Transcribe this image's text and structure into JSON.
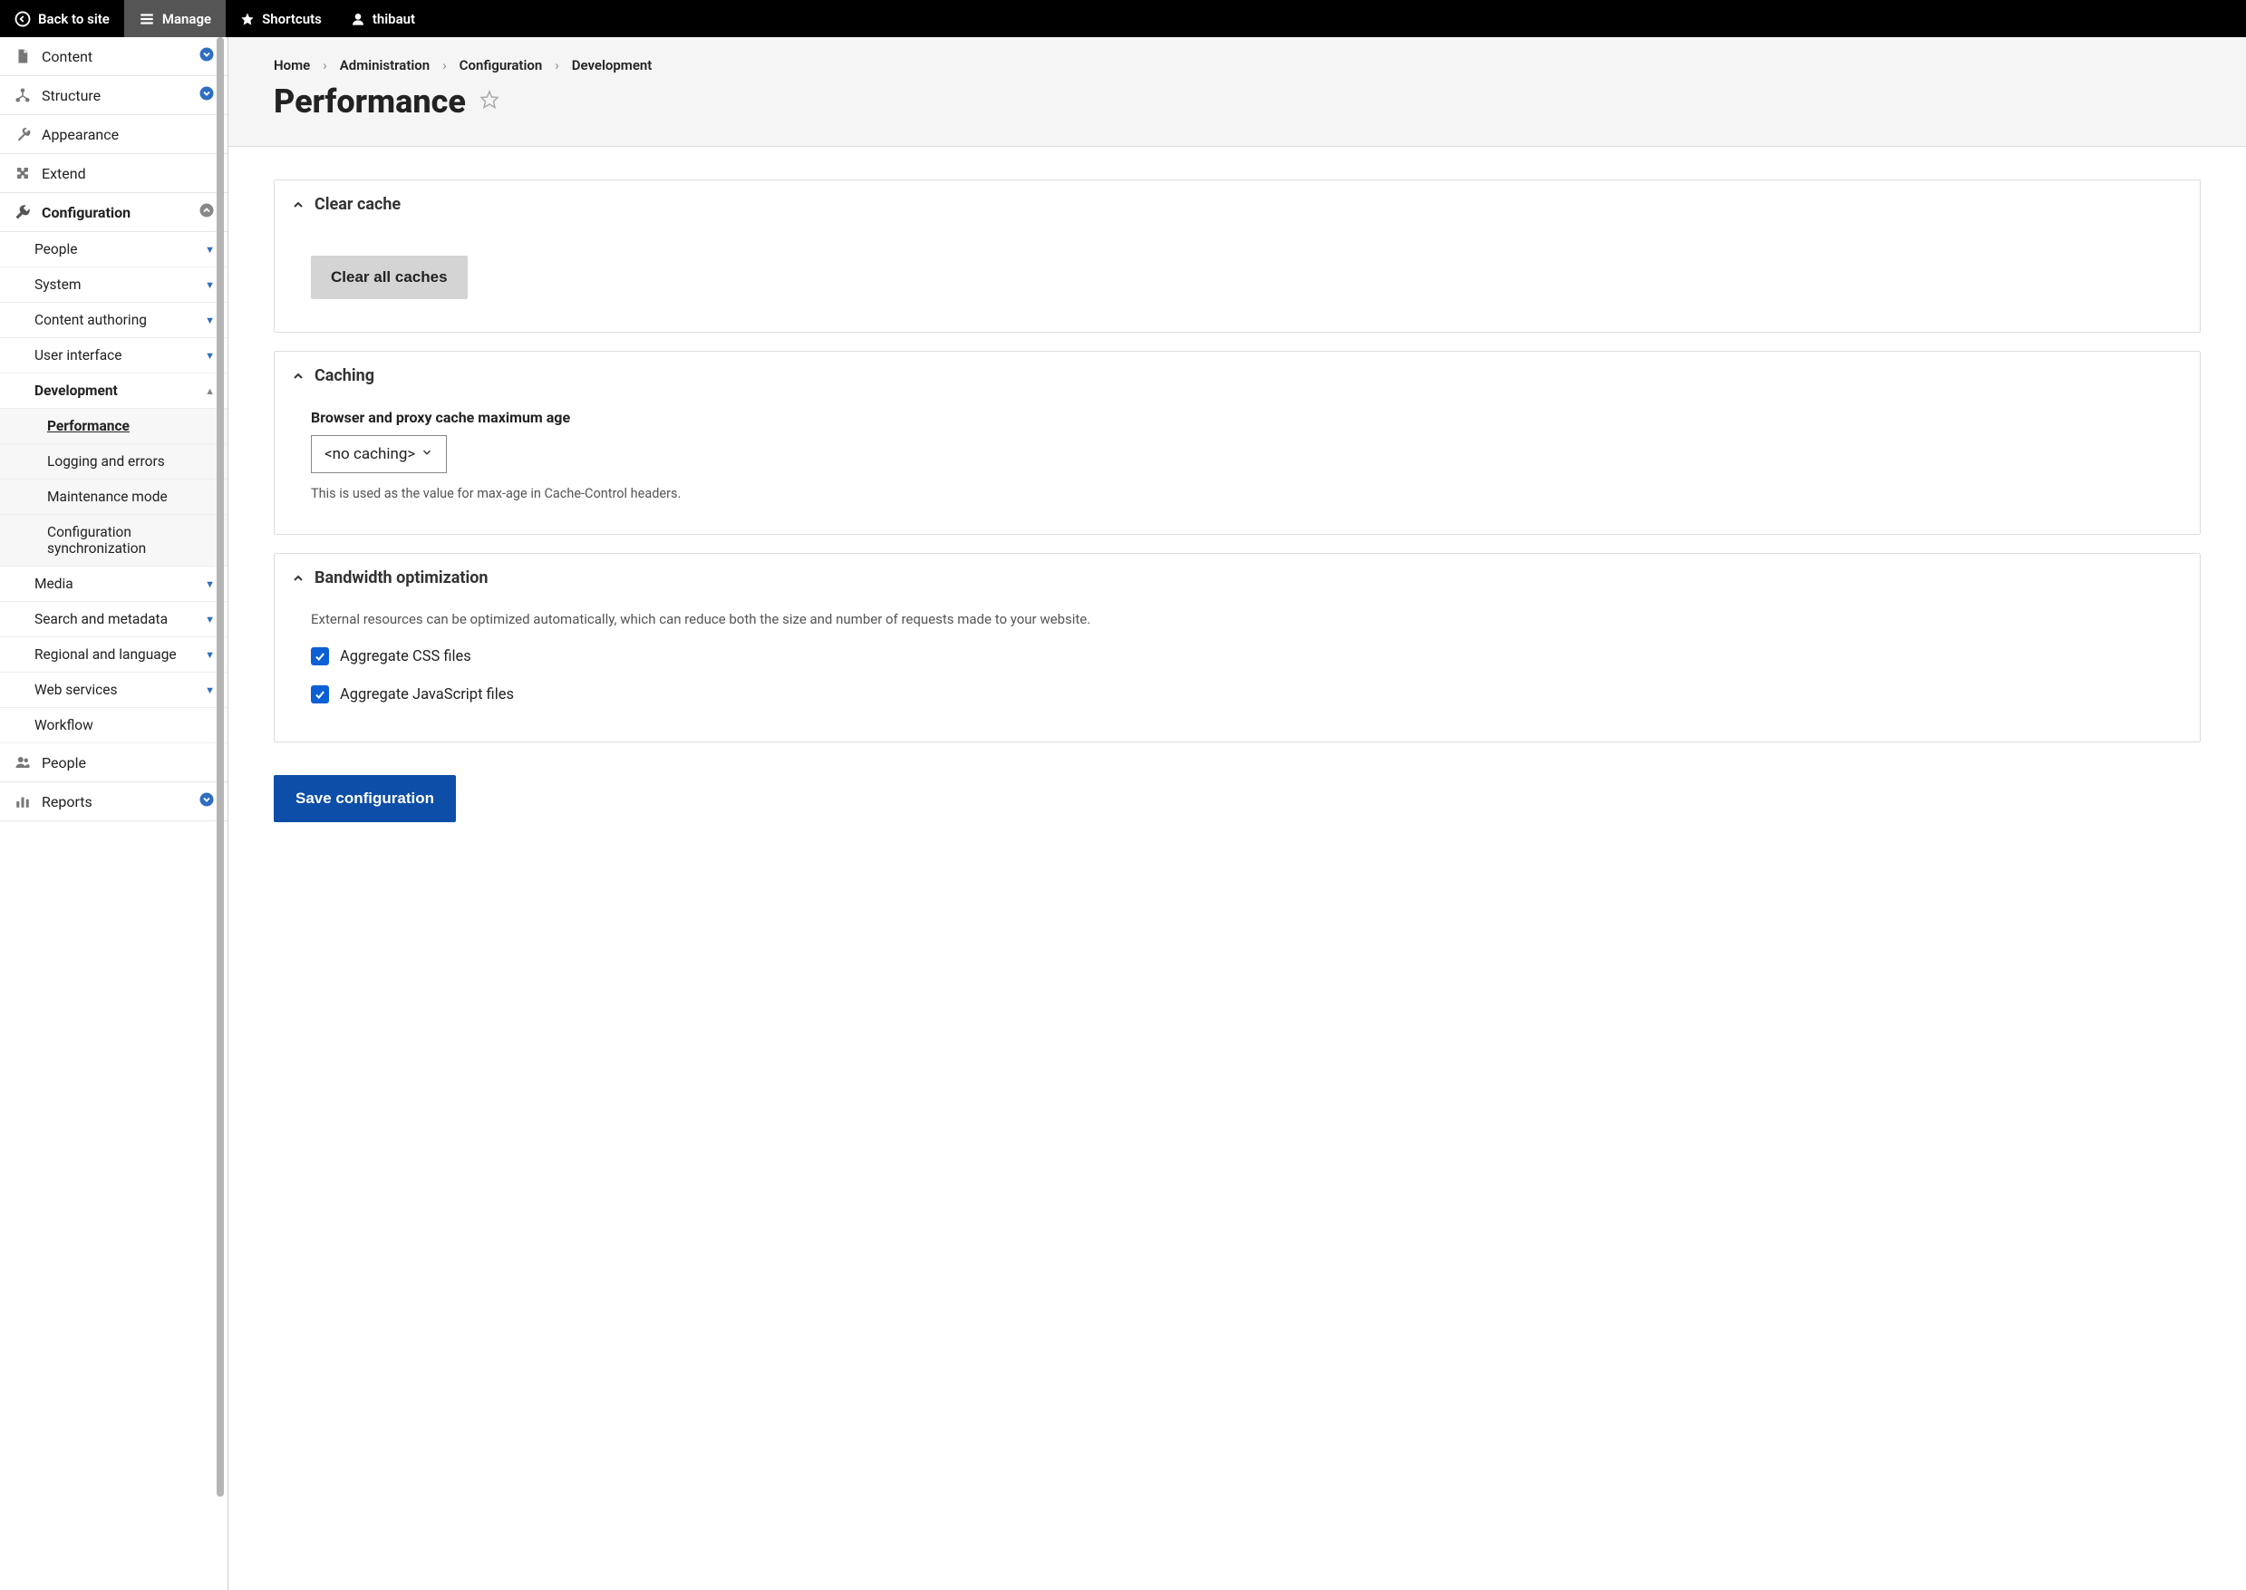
{
  "toolbar": {
    "back_label": "Back to site",
    "manage_label": "Manage",
    "shortcuts_label": "Shortcuts",
    "user_label": "thibaut"
  },
  "sidebar": {
    "content": "Content",
    "structure": "Structure",
    "appearance": "Appearance",
    "extend": "Extend",
    "configuration": "Configuration",
    "config_children": {
      "people": "People",
      "system": "System",
      "content_authoring": "Content authoring",
      "user_interface": "User interface",
      "development": "Development",
      "dev_children": {
        "performance": "Performance",
        "logging": "Logging and errors",
        "maintenance": "Maintenance mode",
        "config_sync": "Configuration synchronization"
      },
      "media": "Media",
      "search_metadata": "Search and metadata",
      "regional": "Regional and language",
      "web_services": "Web services",
      "workflow": "Workflow"
    },
    "people": "People",
    "reports": "Reports"
  },
  "breadcrumb": [
    "Home",
    "Administration",
    "Configuration",
    "Development"
  ],
  "page_title": "Performance",
  "panels": {
    "clear_cache": {
      "title": "Clear cache",
      "button": "Clear all caches"
    },
    "caching": {
      "title": "Caching",
      "field_label": "Browser and proxy cache maximum age",
      "select_value": "<no caching>",
      "help": "This is used as the value for max-age in Cache-Control headers."
    },
    "bandwidth": {
      "title": "Bandwidth optimization",
      "desc": "External resources can be optimized automatically, which can reduce both the size and number of requests made to your website.",
      "aggregate_css": "Aggregate CSS files",
      "aggregate_js": "Aggregate JavaScript files"
    }
  },
  "save_button": "Save configuration"
}
